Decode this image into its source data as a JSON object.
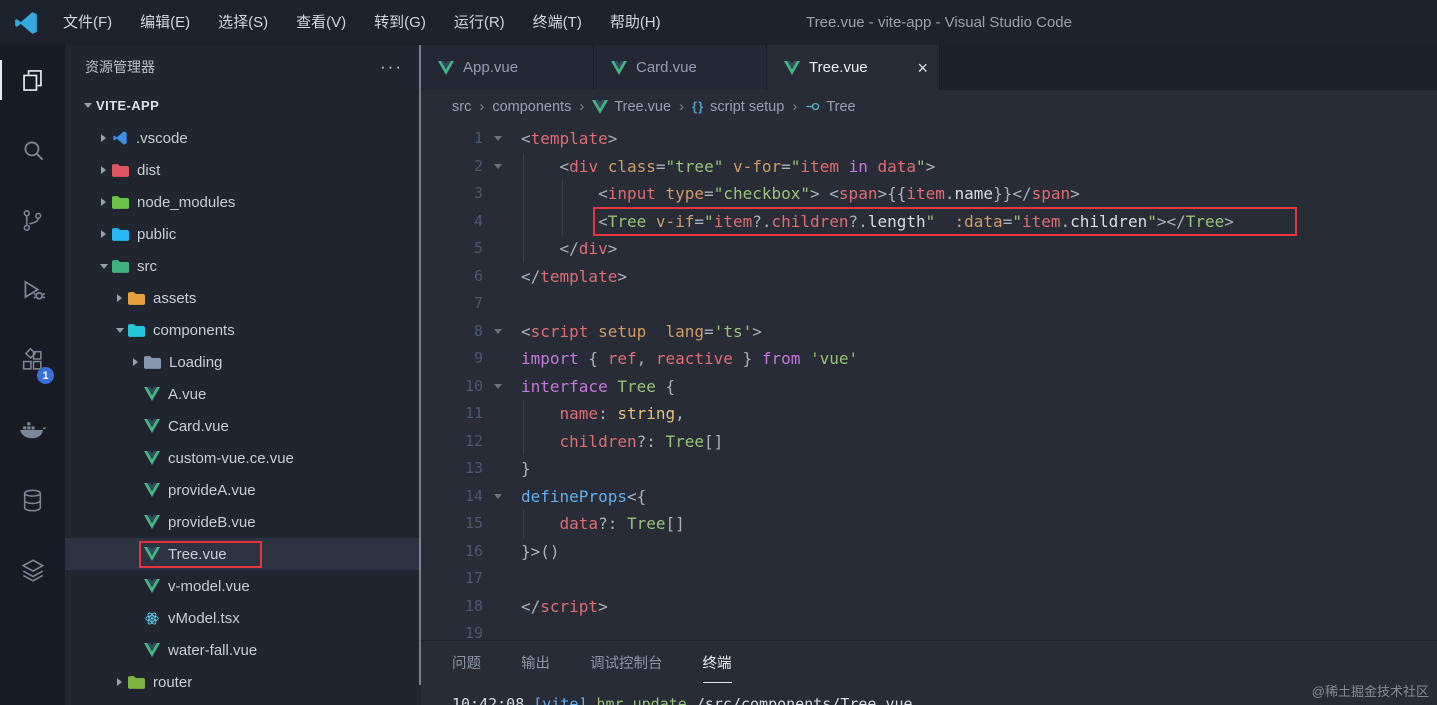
{
  "title_bar": {
    "menus": [
      "文件(F)",
      "编辑(E)",
      "选择(S)",
      "查看(V)",
      "转到(G)",
      "运行(R)",
      "终端(T)",
      "帮助(H)"
    ],
    "title": "Tree.vue - vite-app - Visual Studio Code"
  },
  "activity_bar": {
    "items": [
      {
        "id": "explorer",
        "active": true
      },
      {
        "id": "search"
      },
      {
        "id": "source-control"
      },
      {
        "id": "run-debug"
      },
      {
        "id": "extensions",
        "badge": "1"
      },
      {
        "id": "docker"
      },
      {
        "id": "database"
      },
      {
        "id": "layers"
      }
    ]
  },
  "explorer": {
    "header": "资源管理器",
    "more": "···",
    "root": "VITE-APP",
    "items": [
      {
        "label": ".vscode",
        "indent": 1,
        "chevron": "right",
        "icon": "vscode"
      },
      {
        "label": "dist",
        "indent": 1,
        "chevron": "right",
        "icon": "folder",
        "color": "#e05561"
      },
      {
        "label": "node_modules",
        "indent": 1,
        "chevron": "right",
        "icon": "folder",
        "color": "#6cc24a"
      },
      {
        "label": "public",
        "indent": 1,
        "chevron": "right",
        "icon": "folder",
        "color": "#29b6f6"
      },
      {
        "label": "src",
        "indent": 1,
        "chevron": "down",
        "icon": "folder",
        "color": "#3fb27f"
      },
      {
        "label": "assets",
        "indent": 2,
        "chevron": "right",
        "icon": "folder",
        "color": "#e8a33d"
      },
      {
        "label": "components",
        "indent": 2,
        "chevron": "down",
        "icon": "folder",
        "color": "#26c6da"
      },
      {
        "label": "Loading",
        "indent": 3,
        "chevron": "right",
        "icon": "folder",
        "color": "#8596ad"
      },
      {
        "label": "A.vue",
        "indent": 3,
        "icon": "vue"
      },
      {
        "label": "Card.vue",
        "indent": 3,
        "icon": "vue"
      },
      {
        "label": "custom-vue.ce.vue",
        "indent": 3,
        "icon": "vue"
      },
      {
        "label": "provideA.vue",
        "indent": 3,
        "icon": "vue"
      },
      {
        "label": "provideB.vue",
        "indent": 3,
        "icon": "vue"
      },
      {
        "label": "Tree.vue",
        "indent": 3,
        "icon": "vue",
        "selected": true,
        "highlighted": true
      },
      {
        "label": "v-model.vue",
        "indent": 3,
        "icon": "vue"
      },
      {
        "label": "vModel.tsx",
        "indent": 3,
        "icon": "react"
      },
      {
        "label": "water-fall.vue",
        "indent": 3,
        "icon": "vue"
      },
      {
        "label": "router",
        "indent": 2,
        "chevron": "right",
        "icon": "folder",
        "color": "#7cb342"
      }
    ]
  },
  "editor": {
    "tabs": [
      {
        "label": "App.vue",
        "icon": "vue"
      },
      {
        "label": "Card.vue",
        "icon": "vue"
      },
      {
        "label": "Tree.vue",
        "icon": "vue",
        "active": true,
        "close": "×"
      }
    ],
    "breadcrumb": [
      {
        "label": "src"
      },
      {
        "label": "components"
      },
      {
        "label": "Tree.vue",
        "icon": "vue"
      },
      {
        "label": "script setup",
        "icon": "braces"
      },
      {
        "label": "Tree",
        "icon": "symbol"
      }
    ],
    "code_lines": [
      {
        "n": 1,
        "fold": true,
        "tokens": [
          [
            "P",
            "<"
          ],
          [
            "T",
            "template"
          ],
          [
            "P",
            ">"
          ]
        ]
      },
      {
        "n": 2,
        "fold": true,
        "tokens": [
          [
            "P",
            "    "
          ],
          [
            "P",
            "<"
          ],
          [
            "T",
            "div"
          ],
          [
            "P",
            " "
          ],
          [
            "A",
            "class"
          ],
          [
            "P",
            "="
          ],
          [
            "S",
            "\"tree\""
          ],
          [
            "P",
            " "
          ],
          [
            "A",
            "v-for"
          ],
          [
            "P",
            "="
          ],
          [
            "S",
            "\""
          ],
          [
            "V",
            "item"
          ],
          [
            "K",
            " in "
          ],
          [
            "V",
            "data"
          ],
          [
            "S",
            "\""
          ],
          [
            "P",
            ">"
          ]
        ]
      },
      {
        "n": 3,
        "tokens": [
          [
            "P",
            "        "
          ],
          [
            "P",
            "<"
          ],
          [
            "T",
            "input"
          ],
          [
            "P",
            " "
          ],
          [
            "A",
            "type"
          ],
          [
            "P",
            "="
          ],
          [
            "S",
            "\"checkbox\""
          ],
          [
            "P",
            "> <"
          ],
          [
            "T",
            "span"
          ],
          [
            "P",
            ">"
          ],
          [
            "P",
            "{{"
          ],
          [
            "V",
            "item"
          ],
          [
            "P",
            "."
          ],
          [
            "W",
            "name"
          ],
          [
            "P",
            "}}"
          ],
          [
            "P",
            "</"
          ],
          [
            "T",
            "span"
          ],
          [
            "P",
            ">"
          ]
        ]
      },
      {
        "n": 4,
        "box": true,
        "tokens": [
          [
            "P",
            "        "
          ],
          [
            "P",
            "<"
          ],
          [
            "C",
            "Tree"
          ],
          [
            "P",
            " "
          ],
          [
            "A",
            "v-if"
          ],
          [
            "P",
            "="
          ],
          [
            "S",
            "\""
          ],
          [
            "V",
            "item"
          ],
          [
            "P",
            "?."
          ],
          [
            "V",
            "children"
          ],
          [
            "P",
            "?."
          ],
          [
            "W",
            "length"
          ],
          [
            "S",
            "\""
          ],
          [
            "P",
            "  "
          ],
          [
            "A",
            ":data"
          ],
          [
            "P",
            "="
          ],
          [
            "S",
            "\""
          ],
          [
            "V",
            "item"
          ],
          [
            "P",
            "."
          ],
          [
            "W",
            "children"
          ],
          [
            "S",
            "\""
          ],
          [
            "P",
            "></"
          ],
          [
            "C",
            "Tree"
          ],
          [
            "P",
            ">"
          ]
        ]
      },
      {
        "n": 5,
        "tokens": [
          [
            "P",
            "    "
          ],
          [
            "P",
            "</"
          ],
          [
            "T",
            "div"
          ],
          [
            "P",
            ">"
          ]
        ]
      },
      {
        "n": 6,
        "tokens": [
          [
            "P",
            "</"
          ],
          [
            "T",
            "template"
          ],
          [
            "P",
            ">"
          ]
        ]
      },
      {
        "n": 7,
        "tokens": []
      },
      {
        "n": 8,
        "fold": true,
        "tokens": [
          [
            "P",
            "<"
          ],
          [
            "T",
            "script"
          ],
          [
            "P",
            " "
          ],
          [
            "A",
            "setup"
          ],
          [
            "P",
            "  "
          ],
          [
            "A",
            "lang"
          ],
          [
            "P",
            "="
          ],
          [
            "S",
            "'ts'"
          ],
          [
            "P",
            ">"
          ]
        ]
      },
      {
        "n": 9,
        "tokens": [
          [
            "K",
            "import"
          ],
          [
            "P",
            " { "
          ],
          [
            "V",
            "ref"
          ],
          [
            "P",
            ", "
          ],
          [
            "V",
            "reactive"
          ],
          [
            "P",
            " } "
          ],
          [
            "K",
            "from"
          ],
          [
            "P",
            " "
          ],
          [
            "S",
            "'vue'"
          ]
        ]
      },
      {
        "n": 10,
        "fold": true,
        "tokens": [
          [
            "K",
            "interface"
          ],
          [
            "P",
            " "
          ],
          [
            "C",
            "Tree"
          ],
          [
            "P",
            " {"
          ]
        ]
      },
      {
        "n": 11,
        "tokens": [
          [
            "P",
            "    "
          ],
          [
            "V",
            "name"
          ],
          [
            "P",
            ": "
          ],
          [
            "Y",
            "string"
          ],
          [
            "P",
            ","
          ]
        ]
      },
      {
        "n": 12,
        "tokens": [
          [
            "P",
            "    "
          ],
          [
            "V",
            "children"
          ],
          [
            "P",
            "?: "
          ],
          [
            "C",
            "Tree"
          ],
          [
            "P",
            "[]"
          ]
        ]
      },
      {
        "n": 13,
        "tokens": [
          [
            "P",
            "}"
          ]
        ]
      },
      {
        "n": 14,
        "fold": true,
        "tokens": [
          [
            "F",
            "defineProps"
          ],
          [
            "P",
            "<{"
          ]
        ]
      },
      {
        "n": 15,
        "tokens": [
          [
            "P",
            "    "
          ],
          [
            "V",
            "data"
          ],
          [
            "P",
            "?: "
          ],
          [
            "C",
            "Tree"
          ],
          [
            "P",
            "[]"
          ]
        ]
      },
      {
        "n": 16,
        "tokens": [
          [
            "P",
            "}>()"
          ]
        ]
      },
      {
        "n": 17,
        "tokens": []
      },
      {
        "n": 18,
        "tokens": [
          [
            "P",
            "</"
          ],
          [
            "T",
            "script"
          ],
          [
            "P",
            ">"
          ]
        ]
      },
      {
        "n": 19,
        "tokens": []
      }
    ]
  },
  "panel": {
    "tabs": [
      {
        "label": "问题"
      },
      {
        "label": "输出"
      },
      {
        "label": "调试控制台"
      },
      {
        "label": "终端",
        "active": true
      }
    ],
    "terminal_line": [
      [
        "W",
        "10:42:08 "
      ],
      [
        "F",
        "[vite]"
      ],
      [
        "S",
        " hmr update "
      ],
      [
        "W",
        "/src/components/Tree.vue"
      ]
    ]
  },
  "watermark": "@稀土掘金技术社区",
  "annotations": {
    "highlight_color": "#e5353f"
  }
}
